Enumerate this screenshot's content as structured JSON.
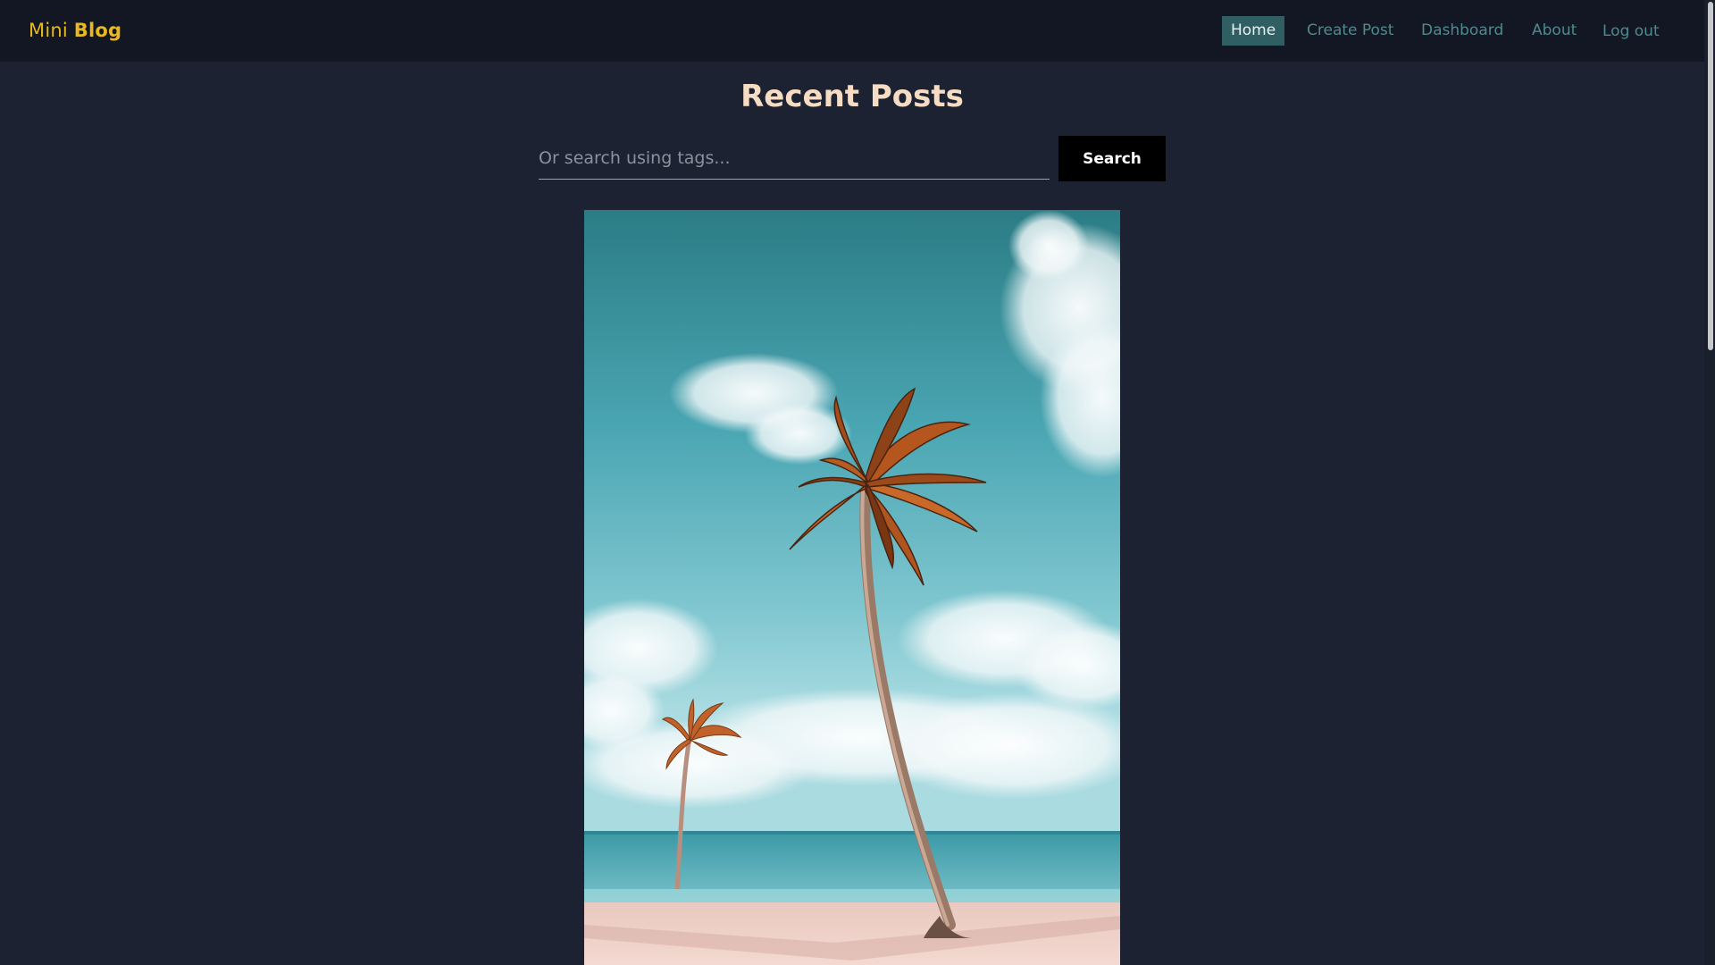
{
  "brand": {
    "light": "Mini",
    "bold": "Blog"
  },
  "nav": {
    "items": [
      {
        "label": "Home",
        "active": true
      },
      {
        "label": "Create Post",
        "active": false
      },
      {
        "label": "Dashboard",
        "active": false
      },
      {
        "label": "About",
        "active": false
      },
      {
        "label": "Log out",
        "active": false
      }
    ]
  },
  "page": {
    "title": "Recent Posts"
  },
  "search": {
    "placeholder": "Or search using tags...",
    "value": "",
    "button_label": "Search"
  },
  "post": {
    "image_subject": "palm trees on a tropical beach"
  },
  "colors": {
    "background": "#1c2232",
    "navbar": "#121723",
    "brand": "#e8b820",
    "nav_link": "#4f8a8e",
    "nav_active_bg": "#2f5f63",
    "title": "#f6dcc3",
    "search_button_bg": "#000000"
  }
}
